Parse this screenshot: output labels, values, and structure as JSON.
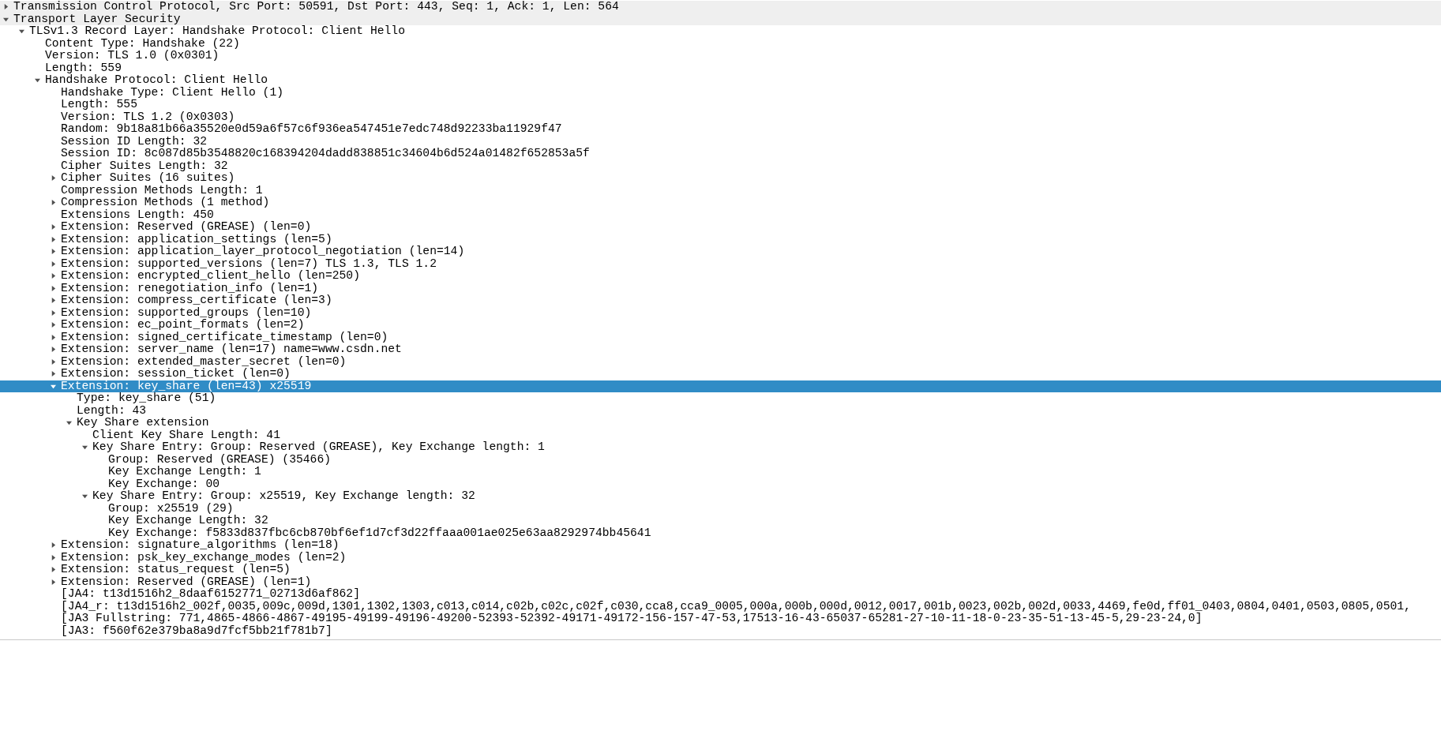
{
  "tree": [
    {
      "text": "Transmission Control Protocol, Src Port: 50591, Dst Port: 443, Seq: 1, Ack: 1, Len: 564",
      "expanded": false,
      "selected": false
    },
    {
      "text": "Transport Layer Security",
      "expanded": true,
      "selected": false,
      "children": [
        {
          "text": "TLSv1.3 Record Layer: Handshake Protocol: Client Hello",
          "expanded": true,
          "selected": false,
          "children": [
            {
              "text": "Content Type: Handshake (22)",
              "selected": false
            },
            {
              "text": "Version: TLS 1.0 (0x0301)",
              "selected": false
            },
            {
              "text": "Length: 559",
              "selected": false
            },
            {
              "text": "Handshake Protocol: Client Hello",
              "expanded": true,
              "selected": false,
              "children": [
                {
                  "text": "Handshake Type: Client Hello (1)",
                  "selected": false
                },
                {
                  "text": "Length: 555",
                  "selected": false
                },
                {
                  "text": "Version: TLS 1.2 (0x0303)",
                  "selected": false
                },
                {
                  "text": "Random: 9b18a81b66a35520e0d59a6f57c6f936ea547451e7edc748d92233ba11929f47",
                  "selected": false
                },
                {
                  "text": "Session ID Length: 32",
                  "selected": false
                },
                {
                  "text": "Session ID: 8c087d85b3548820c168394204dadd838851c34604b6d524a01482f652853a5f",
                  "selected": false
                },
                {
                  "text": "Cipher Suites Length: 32",
                  "selected": false
                },
                {
                  "text": "Cipher Suites (16 suites)",
                  "expanded": false,
                  "selected": false
                },
                {
                  "text": "Compression Methods Length: 1",
                  "selected": false
                },
                {
                  "text": "Compression Methods (1 method)",
                  "expanded": false,
                  "selected": false
                },
                {
                  "text": "Extensions Length: 450",
                  "selected": false
                },
                {
                  "text": "Extension: Reserved (GREASE) (len=0)",
                  "expanded": false,
                  "selected": false
                },
                {
                  "text": "Extension: application_settings (len=5)",
                  "expanded": false,
                  "selected": false
                },
                {
                  "text": "Extension: application_layer_protocol_negotiation (len=14)",
                  "expanded": false,
                  "selected": false
                },
                {
                  "text": "Extension: supported_versions (len=7) TLS 1.3, TLS 1.2",
                  "expanded": false,
                  "selected": false
                },
                {
                  "text": "Extension: encrypted_client_hello (len=250)",
                  "expanded": false,
                  "selected": false
                },
                {
                  "text": "Extension: renegotiation_info (len=1)",
                  "expanded": false,
                  "selected": false
                },
                {
                  "text": "Extension: compress_certificate (len=3)",
                  "expanded": false,
                  "selected": false
                },
                {
                  "text": "Extension: supported_groups (len=10)",
                  "expanded": false,
                  "selected": false
                },
                {
                  "text": "Extension: ec_point_formats (len=2)",
                  "expanded": false,
                  "selected": false
                },
                {
                  "text": "Extension: signed_certificate_timestamp (len=0)",
                  "expanded": false,
                  "selected": false
                },
                {
                  "text": "Extension: server_name (len=17) name=www.csdn.net",
                  "expanded": false,
                  "selected": false
                },
                {
                  "text": "Extension: extended_master_secret (len=0)",
                  "expanded": false,
                  "selected": false
                },
                {
                  "text": "Extension: session_ticket (len=0)",
                  "expanded": false,
                  "selected": false
                },
                {
                  "text": "Extension: key_share (len=43) x25519",
                  "expanded": true,
                  "selected": true,
                  "children": [
                    {
                      "text": "Type: key_share (51)",
                      "selected": false
                    },
                    {
                      "text": "Length: 43",
                      "selected": false
                    },
                    {
                      "text": "Key Share extension",
                      "expanded": true,
                      "selected": false,
                      "children": [
                        {
                          "text": "Client Key Share Length: 41",
                          "selected": false
                        },
                        {
                          "text": "Key Share Entry: Group: Reserved (GREASE), Key Exchange length: 1",
                          "expanded": true,
                          "selected": false,
                          "children": [
                            {
                              "text": "Group: Reserved (GREASE) (35466)",
                              "selected": false
                            },
                            {
                              "text": "Key Exchange Length: 1",
                              "selected": false
                            },
                            {
                              "text": "Key Exchange: 00",
                              "selected": false
                            }
                          ]
                        },
                        {
                          "text": "Key Share Entry: Group: x25519, Key Exchange length: 32",
                          "expanded": true,
                          "selected": false,
                          "children": [
                            {
                              "text": "Group: x25519 (29)",
                              "selected": false
                            },
                            {
                              "text": "Key Exchange Length: 32",
                              "selected": false
                            },
                            {
                              "text": "Key Exchange: f5833d837fbc6cb870bf6ef1d7cf3d22ffaaa001ae025e63aa8292974bb45641",
                              "selected": false
                            }
                          ]
                        }
                      ]
                    }
                  ]
                },
                {
                  "text": "Extension: signature_algorithms (len=18)",
                  "expanded": false,
                  "selected": false
                },
                {
                  "text": "Extension: psk_key_exchange_modes (len=2)",
                  "expanded": false,
                  "selected": false
                },
                {
                  "text": "Extension: status_request (len=5)",
                  "expanded": false,
                  "selected": false
                },
                {
                  "text": "Extension: Reserved (GREASE) (len=1)",
                  "expanded": false,
                  "selected": false
                },
                {
                  "text": "[JA4: t13d1516h2_8daaf6152771_02713d6af862]",
                  "selected": false
                },
                {
                  "text": "[JA4_r: t13d1516h2_002f,0035,009c,009d,1301,1302,1303,c013,c014,c02b,c02c,c02f,c030,cca8,cca9_0005,000a,000b,000d,0012,0017,001b,0023,002b,002d,0033,4469,fe0d,ff01_0403,0804,0401,0503,0805,0501,",
                  "selected": false
                },
                {
                  "text": "[JA3 Fullstring: 771,4865-4866-4867-49195-49199-49196-49200-52393-52392-49171-49172-156-157-47-53,17513-16-43-65037-65281-27-10-11-18-0-23-35-51-13-45-5,29-23-24,0]",
                  "selected": false
                },
                {
                  "text": "[JA3: f560f62e379ba8a9d7fcf5bb21f781b7]",
                  "selected": false
                }
              ]
            }
          ]
        }
      ]
    }
  ]
}
